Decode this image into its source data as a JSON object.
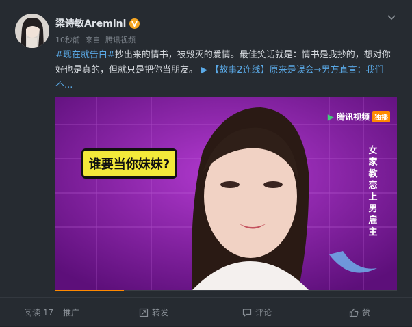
{
  "post": {
    "username": "梁诗敏Aremini",
    "time": "10秒前",
    "source_prefix": "来自",
    "source_name": "腾讯视频",
    "hashtag": "#现在就告白#",
    "body_1": "抄出来的情书，被毁灭的爱情。最佳笑话就是：情书是我抄的，想对你好也是真的，但就只是把你当朋友。",
    "link_text": "【故事2连线】原来是误会→男方直言：我们不...",
    "verified_icon": "verified-v-icon"
  },
  "media": {
    "bubble_text": "谁要当你妹妹?",
    "logo_text": "腾讯视频",
    "logo_tag": "独播",
    "side_caption": "女家教恋上男雇主",
    "progress": 0.2
  },
  "footer": {
    "read_label": "阅读 17",
    "promote_label": "推广",
    "repost_label": "转发",
    "comment_label": "评论",
    "like_label": "赞"
  },
  "colors": {
    "background": "#262b31",
    "link": "#5aa9e6",
    "accent": "#ff8a00",
    "verify": "#f5a623"
  }
}
